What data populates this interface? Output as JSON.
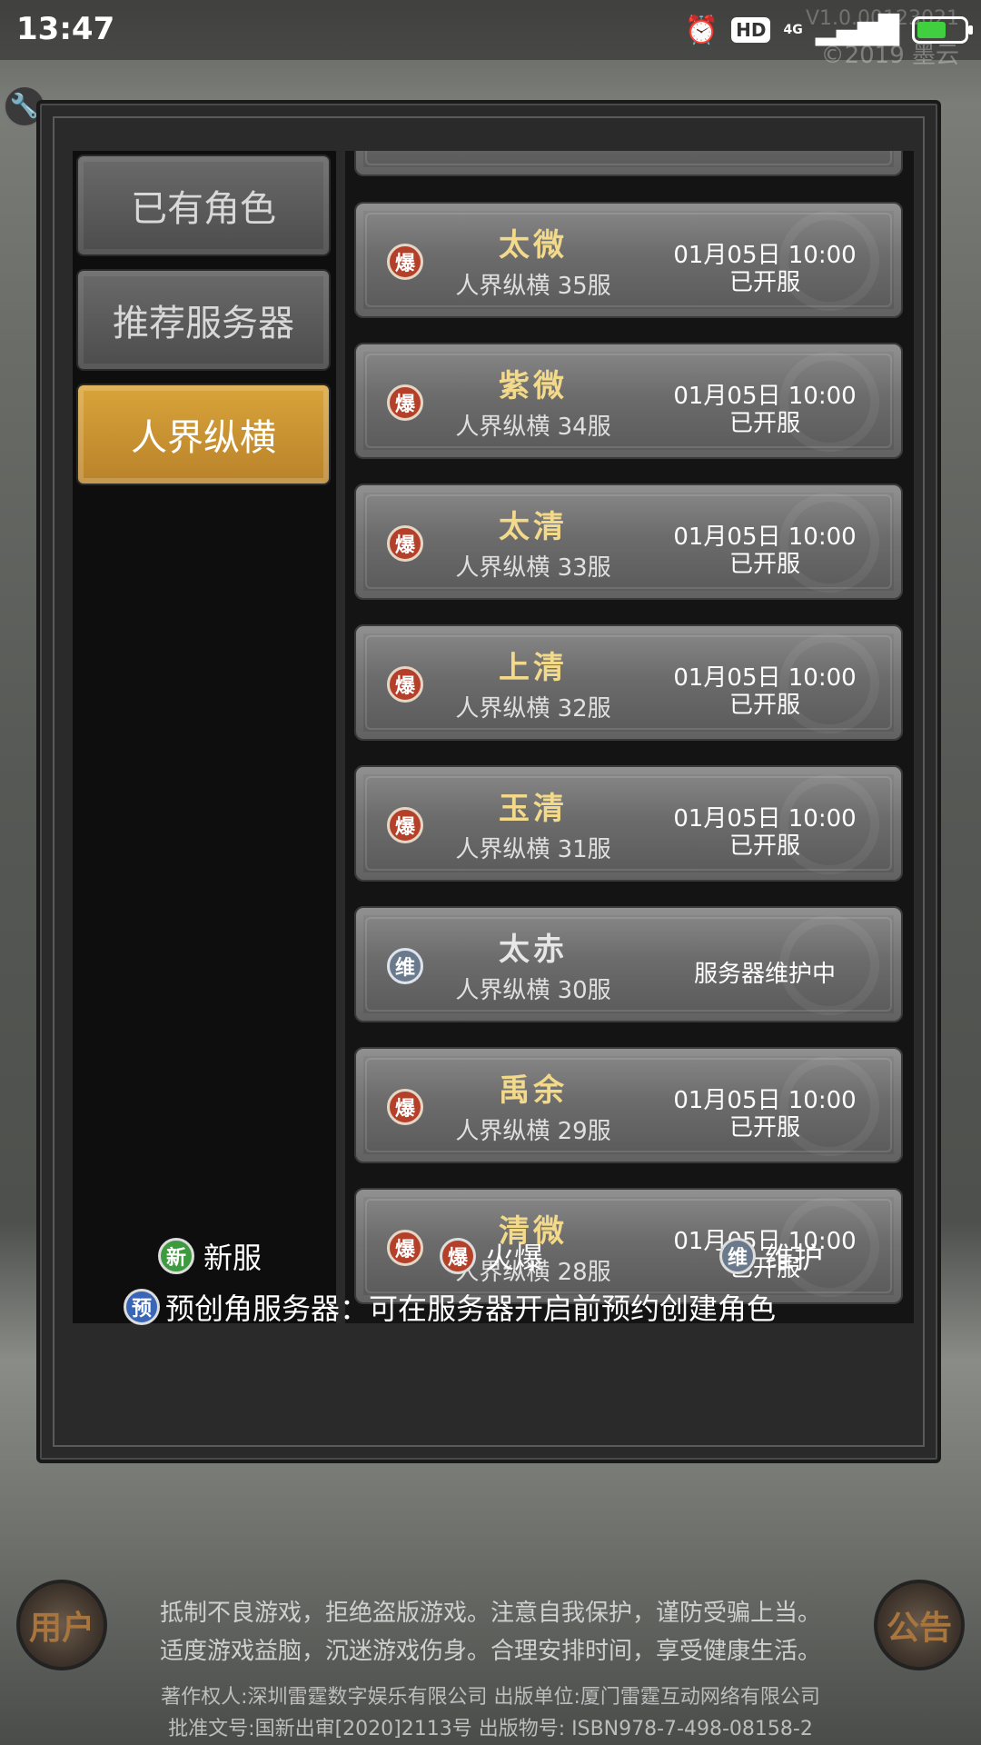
{
  "status_bar": {
    "time": "13:47",
    "network": "4G",
    "hd_label": "HD",
    "version_text": "V1.0.00123021",
    "copyright_text": "©2019 墨云"
  },
  "tabs": [
    {
      "label": "已有角色",
      "active": false
    },
    {
      "label": "推荐服务器",
      "active": false
    },
    {
      "label": "人界纵横",
      "active": true
    }
  ],
  "servers": [
    {
      "badge": "爆",
      "badge_type": "hot",
      "name": "太微",
      "sub": "人界纵横 35服",
      "date": "01月05日 10:00",
      "state": "已开服"
    },
    {
      "badge": "爆",
      "badge_type": "hot",
      "name": "紫微",
      "sub": "人界纵横 34服",
      "date": "01月05日 10:00",
      "state": "已开服"
    },
    {
      "badge": "爆",
      "badge_type": "hot",
      "name": "太清",
      "sub": "人界纵横 33服",
      "date": "01月05日 10:00",
      "state": "已开服"
    },
    {
      "badge": "爆",
      "badge_type": "hot",
      "name": "上清",
      "sub": "人界纵横 32服",
      "date": "01月05日 10:00",
      "state": "已开服"
    },
    {
      "badge": "爆",
      "badge_type": "hot",
      "name": "玉清",
      "sub": "人界纵横 31服",
      "date": "01月05日 10:00",
      "state": "已开服"
    },
    {
      "badge": "维",
      "badge_type": "maint",
      "name": "太赤",
      "sub": "人界纵横 30服",
      "date": "",
      "state": "服务器维护中"
    },
    {
      "badge": "爆",
      "badge_type": "hot",
      "name": "禹余",
      "sub": "人界纵横 29服",
      "date": "01月05日 10:00",
      "state": "已开服"
    },
    {
      "badge": "爆",
      "badge_type": "hot",
      "name": "清微",
      "sub": "人界纵横 28服",
      "date": "01月05日 10:00",
      "state": "已开服"
    }
  ],
  "legend": {
    "new": {
      "badge": "新",
      "label": "新服"
    },
    "hot": {
      "badge": "爆",
      "label": "火爆"
    },
    "maint": {
      "badge": "维",
      "label": "维护"
    },
    "pre": {
      "badge": "预",
      "label": "预创角服务器：可在服务器开启前预约创建角色"
    }
  },
  "footer": {
    "left_button": "用户",
    "right_button": "公告",
    "notice_line1": "抵制不良游戏，拒绝盗版游戏。注意自我保护，谨防受骗上当。",
    "notice_line2": "适度游戏益脑，沉迷游戏伤身。合理安排时间，享受健康生活。",
    "credits_line1": "著作权人:深圳雷霆数字娱乐有限公司 出版单位:厦门雷霆互动网络有限公司",
    "credits_line2": "批准文号:国新出审[2020]2113号 出版物号: ISBN978-7-498-08158-2"
  },
  "colors": {
    "active_tab": "#c9932f",
    "server_name": "#f3d98a",
    "hot_badge": "#b4402a",
    "maint_badge": "#6a7a8c",
    "new_badge": "#3e9a3e",
    "pre_badge": "#3a66b8"
  }
}
